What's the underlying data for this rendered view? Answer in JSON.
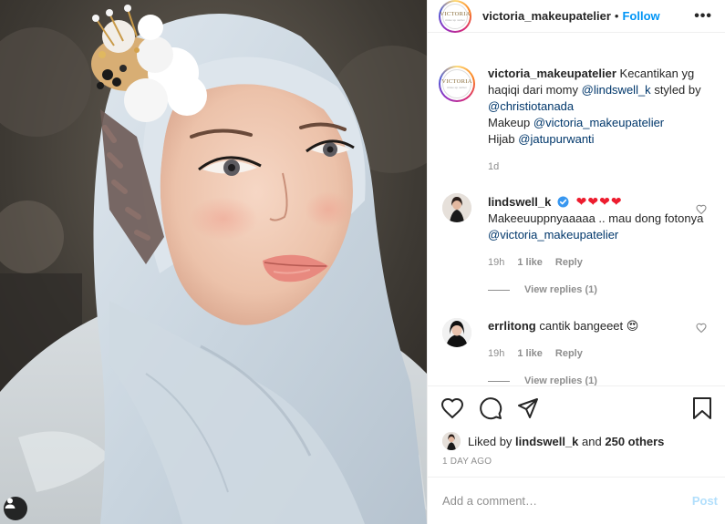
{
  "post": {
    "username": "victoria_makeupatelier",
    "dot": "•",
    "follow_label": "Follow",
    "more_label": "•••",
    "logo_text": "VICTORIA",
    "logo_sub": "make up atelier"
  },
  "caption": {
    "username": "victoria_makeupatelier",
    "text_1": "Kecantikan yg haqiqi dari momy",
    "mention_1": "@lindswell_k",
    "text_2": "styled by",
    "mention_2": "@christiotanada",
    "line_makeup": "Makeup",
    "mention_3": "@victoria_makeupatelier",
    "line_hijab": "Hijab",
    "mention_4": "@jatupurwanti",
    "time": "1d"
  },
  "comments": [
    {
      "username": "lindswell_k",
      "hearts": "❤❤❤❤",
      "text": "Makeeuuppnyaaaaa .. mau dong fotonya",
      "mention": "@victoria_makeupatelier",
      "time": "19h",
      "likes": "1 like",
      "reply": "Reply",
      "view_replies": "View replies (1)"
    },
    {
      "username": "errlitong",
      "text": "cantik bangeeet",
      "emoji": "😍",
      "time": "19h",
      "likes": "1 like",
      "reply": "Reply",
      "view_replies": "View replies (1)"
    }
  ],
  "likes": {
    "prefix": "Liked by",
    "user": "lindswell_k",
    "and": "and",
    "others": "250 others"
  },
  "date": "1 DAY AGO",
  "add_comment": {
    "placeholder": "Add a comment…",
    "post_label": "Post"
  },
  "colors": {
    "link": "#00376b",
    "follow": "#0095f6",
    "heart": "#ed1c2e",
    "muted": "#8e8e8e"
  },
  "icons": {
    "like": "heart-icon",
    "comment": "comment-icon",
    "share": "paper-plane-icon",
    "save": "bookmark-icon",
    "more": "more-icon",
    "user_tag": "user-tag-icon",
    "verified": "verified-badge-icon"
  }
}
